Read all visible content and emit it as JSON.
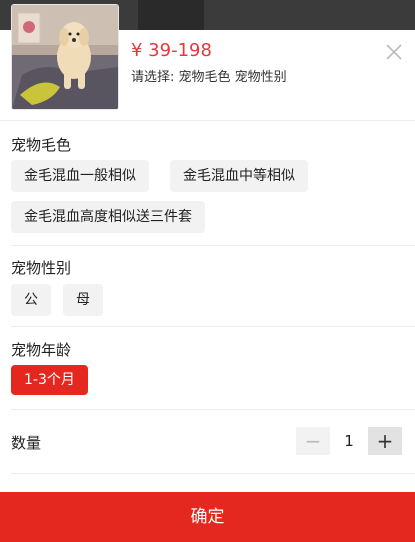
{
  "product": {
    "price": "¥ 39-198",
    "select_tip": "请选择: 宠物毛色 宠物性别"
  },
  "sections": {
    "color": {
      "title": "宠物毛色",
      "options": [
        "金毛混血一般相似",
        "金毛混血中等相似",
        "金毛混血高度相似送三件套"
      ]
    },
    "gender": {
      "title": "宠物性别",
      "options": [
        "公",
        "母"
      ]
    },
    "age": {
      "title": "宠物年龄",
      "options": [
        "1-3个月"
      ],
      "selected_index": 0
    }
  },
  "quantity": {
    "label": "数量",
    "value": "1",
    "minus": "−",
    "plus": "+"
  },
  "confirm_label": "确定",
  "colors": {
    "accent": "#e4281f",
    "price": "#e4393c",
    "chip_bg": "#f2f2f2"
  }
}
